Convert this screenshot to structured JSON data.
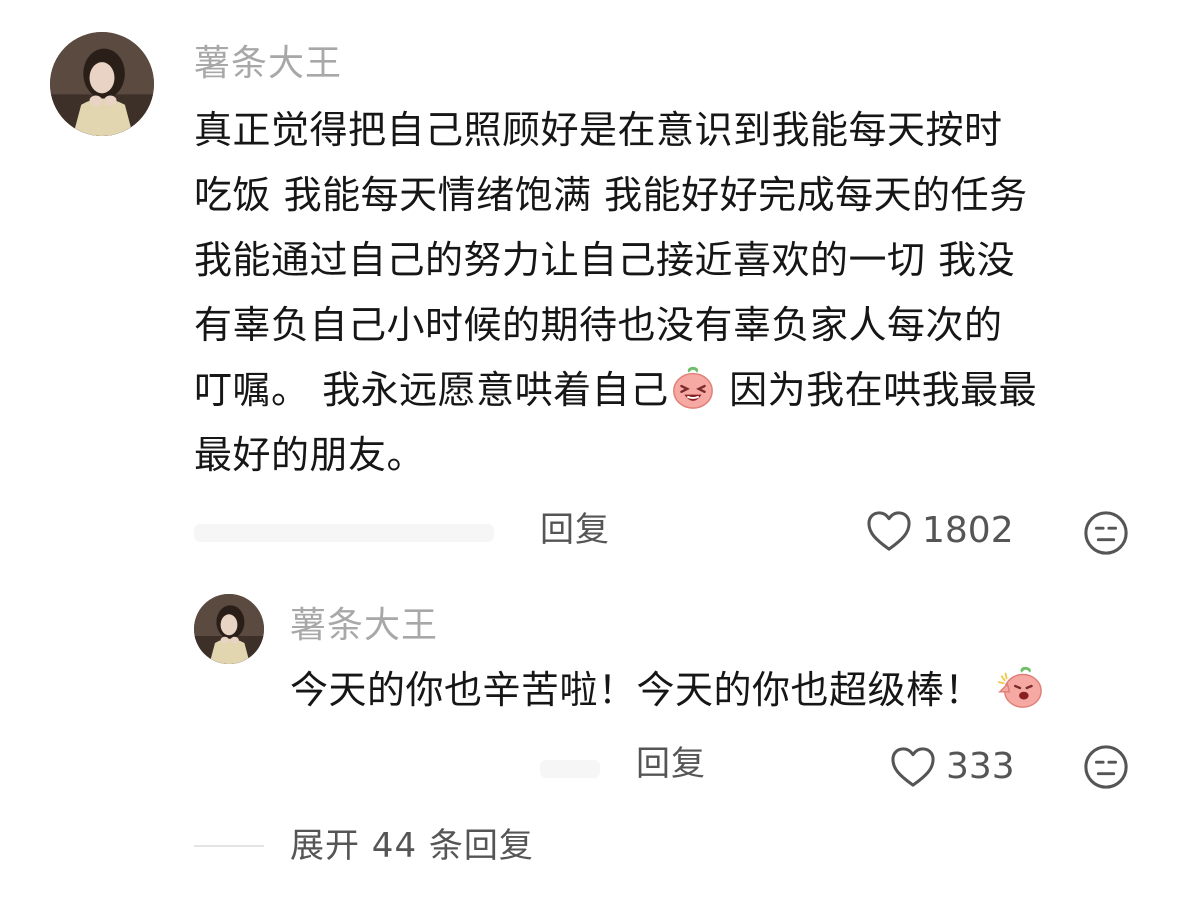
{
  "comment": {
    "username": "薯条大王",
    "lines": [
      "真正觉得把自己照顾好是在意识到我能每天按时",
      "吃饭 我能每天情绪饱满 我能好好完成每天的任务",
      "我能通过自己的努力让自己接近喜欢的一切 我没",
      "有辜负自己小时候的期待也没有辜负家人每次的"
    ],
    "line5_before_emoji": "叮嘱。 我永远愿意哄着自己",
    "line5_after_emoji": " 因为我在哄我最最",
    "line6": "最好的朋友。",
    "emoji": "laughing-peach-emoji",
    "reply_label": "回复",
    "like_count": "1802"
  },
  "reply": {
    "username": "薯条大王",
    "text": "今天的你也辛苦啦！今天的你也超级棒！",
    "emoji": "cheering-peach-emoji",
    "reply_label": "回复",
    "like_count": "333"
  },
  "expand_label": "展开 44 条回复",
  "colors": {
    "username": "#a8a8a8",
    "text": "#161616",
    "secondary": "#555555",
    "emoji_pink": "#f6a9a3"
  }
}
